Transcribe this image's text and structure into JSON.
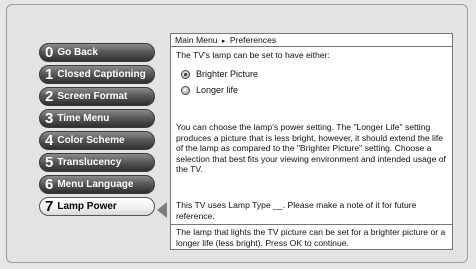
{
  "menu": {
    "items": [
      {
        "num": "0",
        "label": "Go Back"
      },
      {
        "num": "1",
        "label": "Closed Captioning"
      },
      {
        "num": "2",
        "label": "Screen Format"
      },
      {
        "num": "3",
        "label": "Time Menu"
      },
      {
        "num": "4",
        "label": "Color Scheme"
      },
      {
        "num": "5",
        "label": "Translucency"
      },
      {
        "num": "6",
        "label": "Menu Language"
      },
      {
        "num": "7",
        "label": "Lamp Power"
      }
    ],
    "selected_index": 7
  },
  "panel": {
    "breadcrumb": {
      "root": "Main Menu",
      "separator": "▸",
      "current": "Preferences"
    },
    "intro": "The TV's lamp can be set to have either:",
    "options": [
      {
        "label": "Brighter Picture",
        "selected": true
      },
      {
        "label": "Longer life",
        "selected": false
      }
    ],
    "description": "You can choose the lamp's power setting. The \"Longer Life\" setting produces a picture that is less bright, however, it should extend the life of the lamp as compared to the \"Brighter Picture\" setting. Choose a selection that best fits your viewing environment and intended usage of the TV.",
    "lamp_note": "This TV uses Lamp Type __. Please make a note of it for future reference.",
    "help_text": "The lamp that lights the TV picture can be set for a brighter picture or a longer life (less bright). Press OK to continue."
  }
}
